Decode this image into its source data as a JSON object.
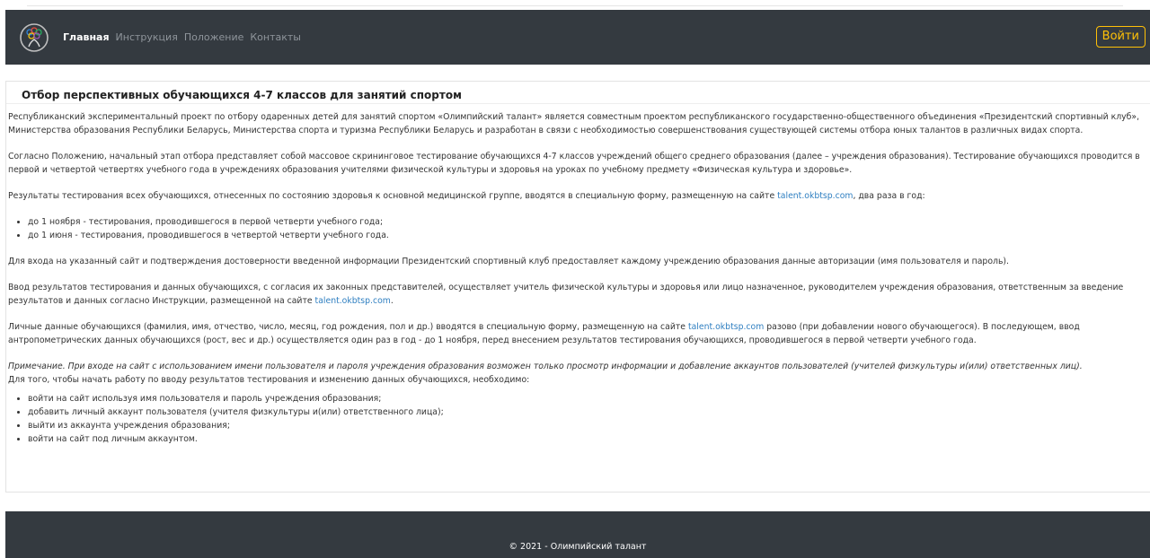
{
  "brand": {
    "logo_icon": "olympic-talent-logo-icon"
  },
  "nav": {
    "items": [
      {
        "label": "Главная",
        "active": true
      },
      {
        "label": "Инструкция",
        "active": false
      },
      {
        "label": "Положение",
        "active": false
      },
      {
        "label": "Контакты",
        "active": false
      }
    ],
    "login_label": "Войти"
  },
  "colors": {
    "navbar_bg": "#343a40",
    "login_accent": "#ffc107",
    "link": "#2f7fc1",
    "footer_bg": "#343a40"
  },
  "main": {
    "title": "Отбор перспективных обучающихся 4-7 классов для занятий спортом",
    "p1": "Республиканский экспериментальный проект по отбору одаренных детей для занятий спортом «Олимпийский талант» является совместным проектом республиканского государственно-общественного объединения «Президентский спортивный клуб», Министерства образования Республики Беларусь, Министерства спорта и туризма Республики Беларусь и разработан в связи с необходимостью совершенствования существующей системы отбора юных талантов в различных видах спорта.",
    "p2": "Согласно Положению, начальный этап отбора представляет собой массовое скрининговое тестирование обучающихся 4-7 классов учреждений общего среднего образования (далее – учреждения образования). Тестирование обучающихся проводится в первой и четвертой четвертях учебного года в учреждениях образования учителями физической культуры и здоровья на уроках по учебному предмету «Физическая культура и здоровье».",
    "p3_before": "Результаты тестирования всех обучающихся, отнесенных по состоянию здоровья к основной медицинской группе, вводятся в специальную форму, размещенную на сайте ",
    "p3_link": "talent.okbtsp.com",
    "p3_after": ", два раза в год:",
    "list1": [
      "до 1 ноября - тестирования, проводившегося в первой четверти учебного года;",
      "до 1 июня - тестирования, проводившегося в четвертой четверти учебного года."
    ],
    "p4": "Для входа на указанный сайт и подтверждения достоверности введенной информации Президентский спортивный клуб предоставляет каждому учреждению образования данные авторизации (имя пользователя и пароль).",
    "p5_before": "Ввод результатов тестирования и данных обучающихся, с согласия их законных представителей, осуществляет учитель физической культуры и здоровья или лицо назначенное, руководителем учреждения образования, ответственным за введение результатов и данных согласно Инструкции, размещенной на сайте ",
    "p5_link": "talent.okbtsp.com",
    "p5_after": ".",
    "p6_before": "Личные данные обучающихся (фамилия, имя, отчество, число, месяц, год рождения, пол и др.) вводятся в специальную форму, размещенную на сайте ",
    "p6_link": "talent.okbtsp.com",
    "p6_after": " разово (при добавлении нового обучающегося). В последующем, ввод антропометрических данных обучающихся (рост, вес и др.) осуществляется один раз в год - до 1 ноября, перед внесением результатов тестирования обучающихся, проводившегося в первой четверти учебного года.",
    "note_em": "Примечание. При входе на сайт с использованием имени пользователя и пароля учреждения образования возможен только просмотр информации и добавление аккаунтов пользователей (учителей физкультуры и(или) ответственных лиц).",
    "note_after": "Для того, чтобы начать работу по вводу результатов тестирования и изменению данных обучающихся, необходимо:",
    "list2": [
      "войти на сайт используя имя пользователя и пароль учреждения образования;",
      "добавить личный аккаунт пользователя (учителя физкультуры и(или) ответственного лица);",
      "выйти из аккаунта учреждения образования;",
      "войти на сайт под личным аккаунтом."
    ]
  },
  "footer": {
    "text": "© 2021 - Олимпийский талант"
  }
}
